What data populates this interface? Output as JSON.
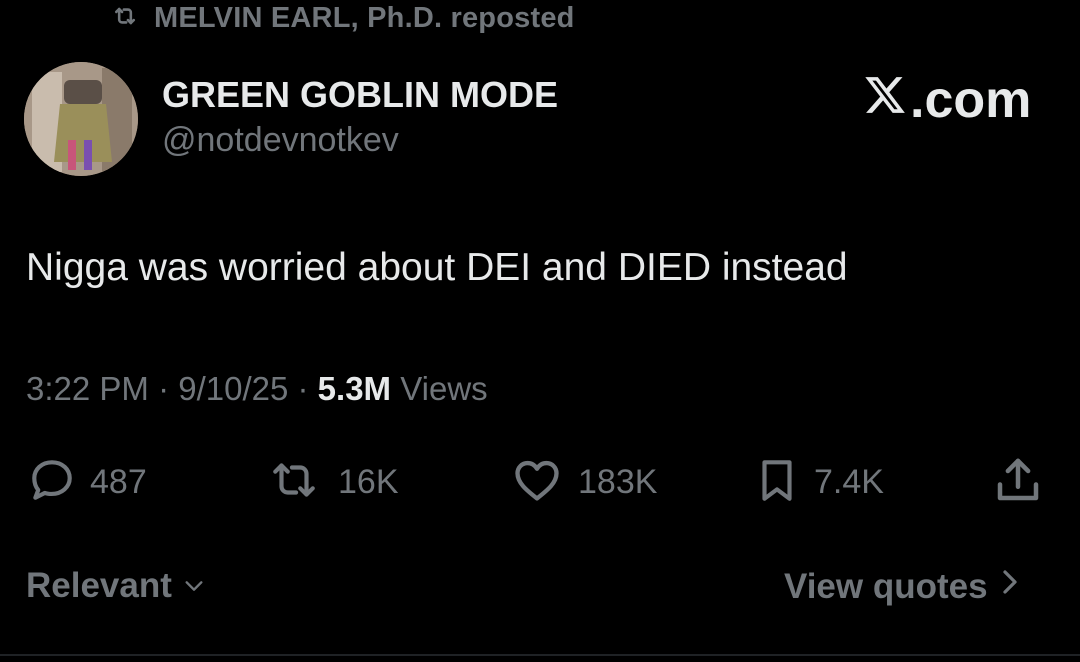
{
  "repost": {
    "label": "MELVIN EARL, Ph.D. reposted",
    "icon": "repost-icon"
  },
  "author": {
    "display_name": "GREEN GOBLIN MODE",
    "handle": "@notdevnotkev",
    "avatar": "user-avatar"
  },
  "brand": {
    "label": ".com",
    "logo": "x-logo-icon"
  },
  "tweet": {
    "text": "Nigga was worried about DEI and DIED instead"
  },
  "meta": {
    "time": "3:22 PM",
    "sep1": " · ",
    "date": "9/10/25",
    "sep2": " · ",
    "views_count": "5.3M",
    "views_label": " Views"
  },
  "actions": {
    "replies": {
      "count": "487",
      "icon": "reply-icon"
    },
    "reposts": {
      "count": "16K",
      "icon": "repost-icon"
    },
    "likes": {
      "count": "183K",
      "icon": "heart-icon"
    },
    "bookmarks": {
      "count": "7.4K",
      "icon": "bookmark-icon"
    },
    "share": {
      "icon": "share-icon"
    }
  },
  "footer": {
    "sort_label": "Relevant",
    "quotes_label": "View quotes"
  },
  "colors": {
    "background": "#000000",
    "primary_text": "#e7e9ea",
    "secondary_text": "#71767b"
  }
}
